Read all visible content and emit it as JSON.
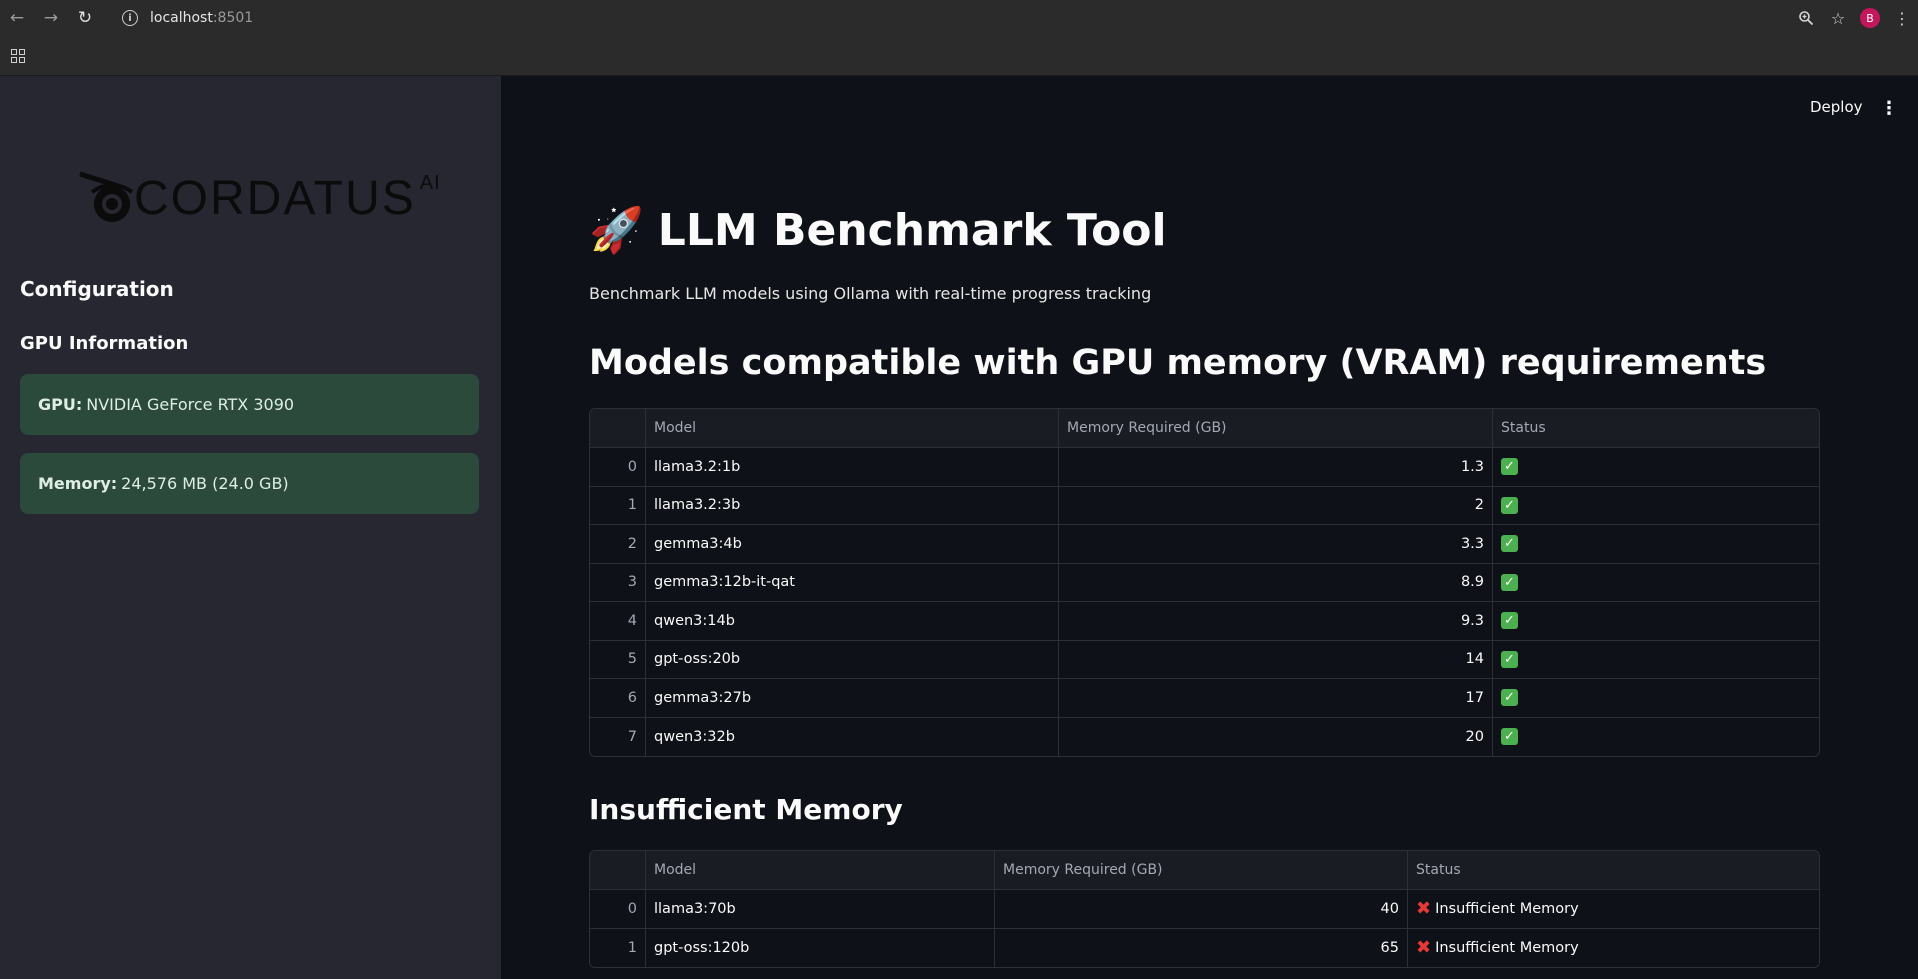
{
  "browser": {
    "host": "localhost",
    "port": ":8501",
    "avatar_letter": "B"
  },
  "sidebar": {
    "logo_text": "CORDATUS",
    "logo_ai": "AI",
    "configuration_heading": "Configuration",
    "gpu_info_heading": "GPU Information",
    "gpu_label": "GPU:",
    "gpu_value": "NVIDIA GeForce RTX 3090",
    "memory_label": "Memory:",
    "memory_value": "24,576 MB (24.0 GB)",
    "info_box_color": "#2b4a3c"
  },
  "header": {
    "deploy_label": "Deploy"
  },
  "main": {
    "title": "LLM Benchmark Tool",
    "subtitle": "Benchmark LLM models using Ollama with real-time progress tracking",
    "compatible_heading": "Models compatible with GPU memory (VRAM) requirements",
    "insufficient_heading": "Insufficient Memory",
    "columns": {
      "model": "Model",
      "memory": "Memory Required (GB)",
      "status": "Status"
    },
    "compatible_rows": [
      {
        "idx": "0",
        "model": "llama3.2:1b",
        "memory": "1.3"
      },
      {
        "idx": "1",
        "model": "llama3.2:3b",
        "memory": "2"
      },
      {
        "idx": "2",
        "model": "gemma3:4b",
        "memory": "3.3"
      },
      {
        "idx": "3",
        "model": "gemma3:12b-it-qat",
        "memory": "8.9"
      },
      {
        "idx": "4",
        "model": "qwen3:14b",
        "memory": "9.3"
      },
      {
        "idx": "5",
        "model": "gpt-oss:20b",
        "memory": "14"
      },
      {
        "idx": "6",
        "model": "gemma3:27b",
        "memory": "17"
      },
      {
        "idx": "7",
        "model": "qwen3:32b",
        "memory": "20"
      }
    ],
    "insufficient_rows": [
      {
        "idx": "0",
        "model": "llama3:70b",
        "memory": "40",
        "status": "Insufficient Memory"
      },
      {
        "idx": "1",
        "model": "gpt-oss:120b",
        "memory": "65",
        "status": "Insufficient Memory"
      }
    ]
  }
}
